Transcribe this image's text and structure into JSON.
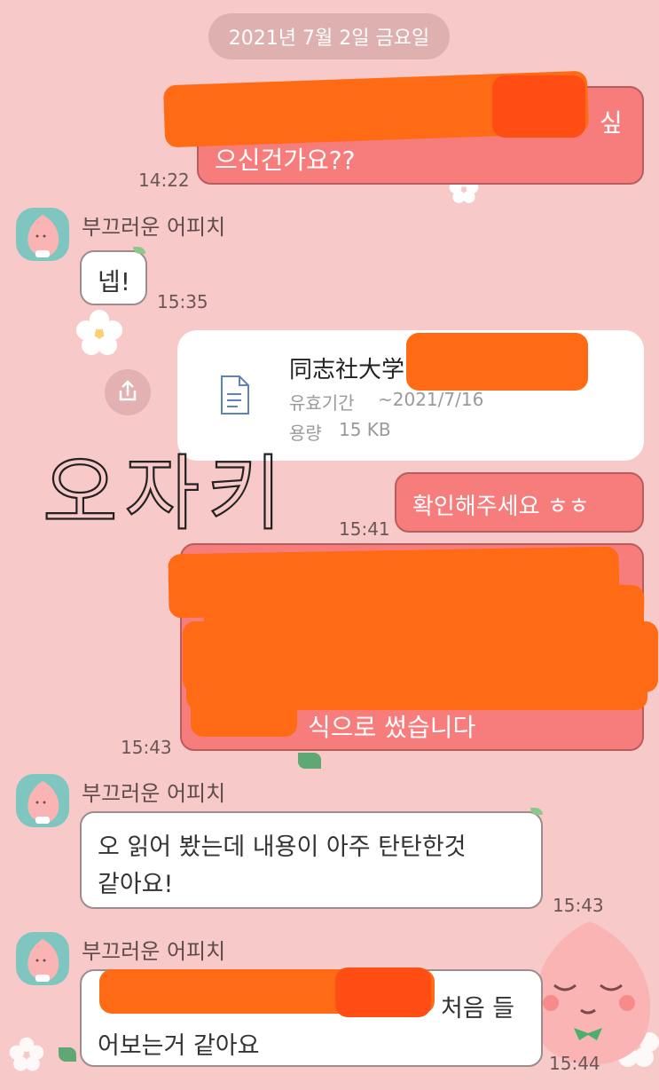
{
  "date_divider": "2021년 7월 2일 금요일",
  "sender_name": "부끄러운 어피치",
  "messages": {
    "m1": {
      "line1_tail": "싶",
      "line2": "으신건가요??",
      "time": "14:22"
    },
    "m2": {
      "text": "넵!",
      "time": "15:35"
    },
    "file": {
      "name": "同志社大学",
      "name_tail": "…",
      "validity_label": "유효기간",
      "validity_value": "~2021/7/16",
      "size_label": "용량",
      "size_value": "15 KB"
    },
    "m3": {
      "text": "확인해주세요 ㅎㅎ",
      "time": "15:41"
    },
    "m4": {
      "tail": "식으로 썼습니다",
      "time": "15:43"
    },
    "m5": {
      "line1": "오 읽어 봤는데 내용이 아주 탄탄한것",
      "line2": "같아요!",
      "time": "15:43"
    },
    "m6": {
      "line1_tail": "처음 들",
      "line2": "어보는거 같아요",
      "time": "15:44"
    }
  },
  "handwriting": "오자키",
  "icons": {
    "file": "document-icon",
    "share": "share-icon",
    "avatar": "peach-avatar-icon"
  },
  "colors": {
    "background": "#f7c9c9",
    "my_bubble": "#f77c7c",
    "redaction": "#ff6a14",
    "avatar_bg": "#7fc6c0"
  }
}
